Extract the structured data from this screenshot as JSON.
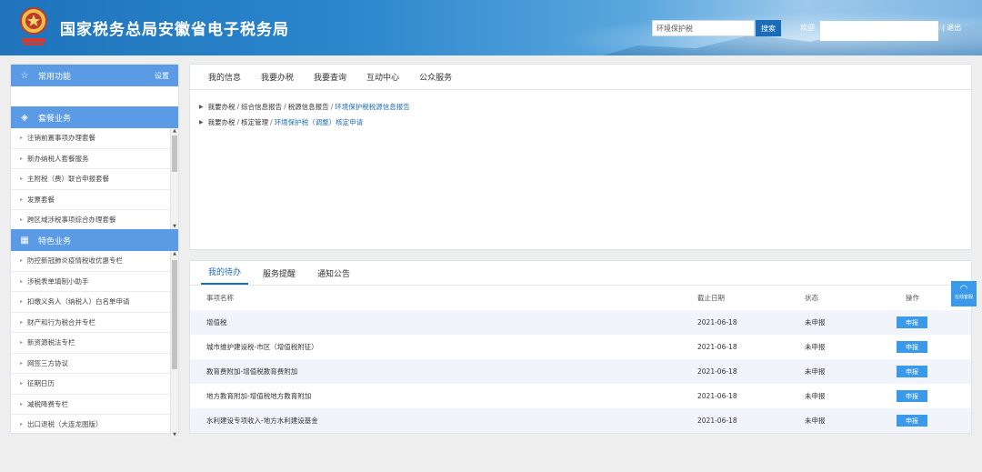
{
  "header": {
    "title": "国家税务总局安徽省电子税务局",
    "search_value": "环境保护税",
    "search_button": "搜索",
    "welcome": "欢迎",
    "logout": "| 退出"
  },
  "sidebar": {
    "favorites": {
      "label": "常用功能",
      "setting": "设置"
    },
    "packages": {
      "label": "套餐业务",
      "items": [
        "注销前置事项办理套餐",
        "新办纳税人套餐服务",
        "主附税（费）联合申报套餐",
        "发票套餐",
        "跨区域涉税事项综合办理套餐"
      ]
    },
    "special": {
      "label": "特色业务",
      "items": [
        "防控新冠肺炎疫情税收优惠专栏",
        "涉税表单填制小助手",
        "扣缴义务人（纳税人）白名单申请",
        "财产和行为税合并专栏",
        "新资源税法专栏",
        "网签三方协议",
        "征期日历",
        "减税降费专栏",
        "出口退税（大连龙图版）"
      ]
    }
  },
  "main_tabs": [
    "我的信息",
    "我要办税",
    "我要查询",
    "互动中心",
    "公众服务"
  ],
  "breadcrumbs": [
    {
      "parts": [
        "我要办税",
        "综合信息报告",
        "税源信息报告"
      ],
      "link": "环境保护税税源信息报告"
    },
    {
      "parts": [
        "我要办税",
        "核定管理"
      ],
      "link": "环境保护税（调整）核定申请"
    }
  ],
  "todo_tabs": [
    "我的待办",
    "服务提醒",
    "通知公告"
  ],
  "todo_table": {
    "headers": {
      "name": "事项名称",
      "deadline": "截止日期",
      "status": "状态",
      "op": "操作"
    },
    "rows": [
      {
        "name": "增值税",
        "deadline": "2021-06-18",
        "status": "未申报",
        "op": "申报"
      },
      {
        "name": "城市维护建设税-市区（增值税附征）",
        "deadline": "2021-06-18",
        "status": "未申报",
        "op": "申报"
      },
      {
        "name": "教育费附加-增值税教育费附加",
        "deadline": "2021-06-18",
        "status": "未申报",
        "op": "申报"
      },
      {
        "name": "地方教育附加-增值税地方教育附加",
        "deadline": "2021-06-18",
        "status": "未申报",
        "op": "申报"
      },
      {
        "name": "水利建设专项收入-地方水利建设基金",
        "deadline": "2021-06-18",
        "status": "未申报",
        "op": "申报"
      }
    ]
  },
  "float_service": {
    "label": "在线客服"
  }
}
